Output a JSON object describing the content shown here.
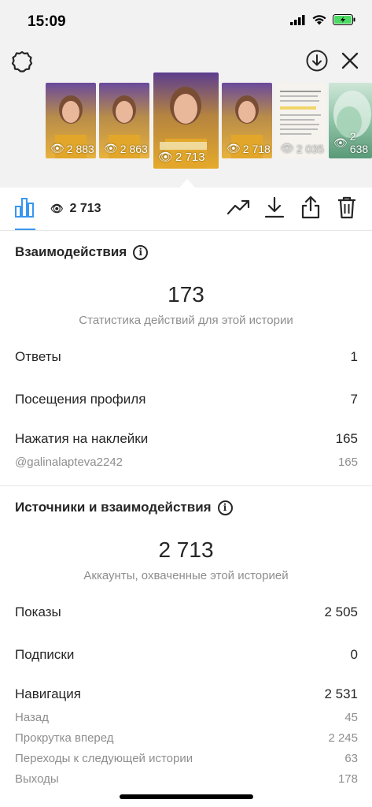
{
  "status_bar": {
    "time": "15:09"
  },
  "stories": [
    {
      "views": "2 883"
    },
    {
      "views": "2 863"
    },
    {
      "views": "2 713"
    },
    {
      "views": "2 718"
    },
    {
      "views": "2 035"
    },
    {
      "views": "2 638"
    }
  ],
  "toolbar": {
    "views": "2 713"
  },
  "interactions": {
    "title": "Взаимодействия",
    "total": "173",
    "subtitle": "Статистика действий для этой истории",
    "rows": [
      {
        "label": "Ответы",
        "value": "1"
      },
      {
        "label": "Посещения профиля",
        "value": "7"
      },
      {
        "label": "Нажатия на наклейки",
        "value": "165"
      }
    ],
    "sticker_rows": [
      {
        "label": "@galinalapteva2242",
        "value": "165"
      }
    ]
  },
  "discovery": {
    "title": "Источники и взаимодействия",
    "total": "2 713",
    "subtitle": "Аккаунты, охваченные этой историей",
    "rows": [
      {
        "label": "Показы",
        "value": "2 505"
      },
      {
        "label": "Подписки",
        "value": "0"
      },
      {
        "label": "Навигация",
        "value": "2 531"
      }
    ],
    "nav_rows": [
      {
        "label": "Назад",
        "value": "45"
      },
      {
        "label": "Прокрутка вперед",
        "value": "2 245"
      },
      {
        "label": "Переходы к следующей истории",
        "value": "63"
      },
      {
        "label": "Выходы",
        "value": "178"
      }
    ]
  },
  "colors": {
    "accent": "#3897f0",
    "battery": "#4cd964"
  }
}
